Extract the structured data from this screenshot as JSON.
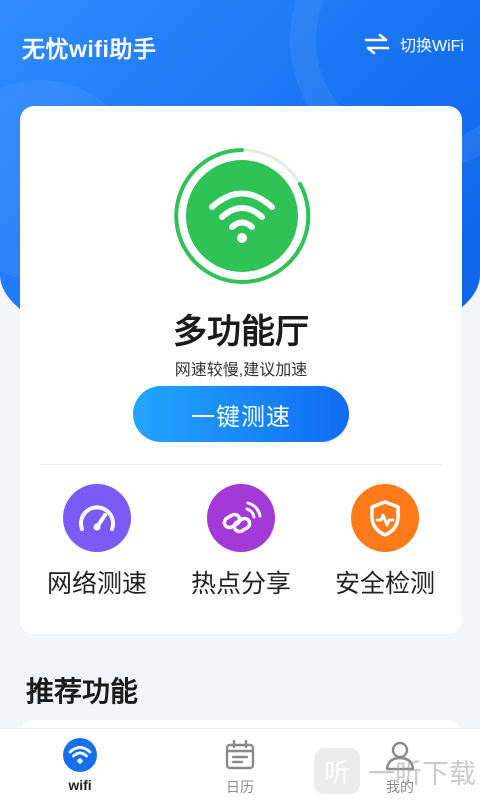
{
  "header": {
    "app_title": "无忧wifi助手",
    "switch_label": "切换WiFi"
  },
  "main": {
    "status_title": "多功能厅",
    "status_subtitle": "网速较慢,建议加速",
    "speed_button": "一键测速",
    "features": [
      {
        "label": "网络测速",
        "icon": "speedometer-icon",
        "color": "#7a5cf5"
      },
      {
        "label": "热点分享",
        "icon": "hotspot-share-icon",
        "color": "#a33ad8"
      },
      {
        "label": "安全检测",
        "icon": "shield-icon",
        "color": "#ff7a1a"
      }
    ]
  },
  "recommend": {
    "title": "推荐功能"
  },
  "tabbar": {
    "items": [
      {
        "label": "wifi",
        "icon": "wifi-icon",
        "active": true
      },
      {
        "label": "日历",
        "icon": "calendar-icon",
        "active": false
      },
      {
        "label": "我的",
        "icon": "profile-icon",
        "active": false
      }
    ]
  },
  "watermark": {
    "badge": "听",
    "text": "一听下载"
  },
  "colors": {
    "brand_blue": "#1570f0",
    "wifi_green": "#2fc256",
    "accent_orange": "#ff7a1a"
  }
}
